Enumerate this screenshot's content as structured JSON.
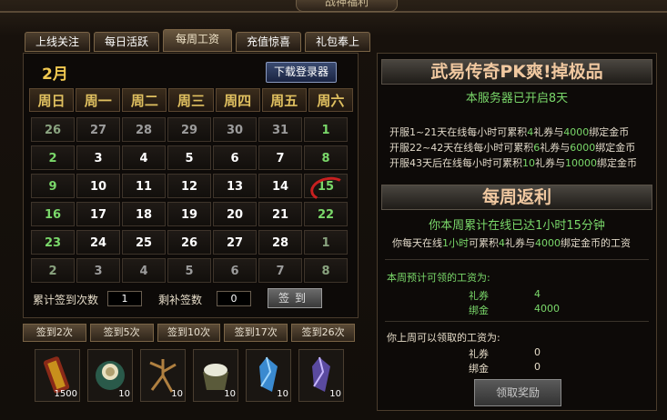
{
  "window": {
    "title": "战神福利"
  },
  "tabs": [
    {
      "label": "上线关注",
      "active": false
    },
    {
      "label": "每日活跃",
      "active": false
    },
    {
      "label": "每周工资",
      "active": true
    },
    {
      "label": "充值惊喜",
      "active": false
    },
    {
      "label": "礼包奉上",
      "active": false
    }
  ],
  "calendar": {
    "month": "2月",
    "download_button": "下载登录器",
    "weekdays": [
      "周日",
      "周一",
      "周二",
      "周三",
      "周四",
      "周五",
      "周六"
    ],
    "days": [
      {
        "d": "26",
        "c": "c-dim"
      },
      {
        "d": "27",
        "c": "c-gray"
      },
      {
        "d": "28",
        "c": "c-gray"
      },
      {
        "d": "29",
        "c": "c-gray"
      },
      {
        "d": "30",
        "c": "c-gray"
      },
      {
        "d": "31",
        "c": "c-gray"
      },
      {
        "d": "1",
        "c": "c-green"
      },
      {
        "d": "2",
        "c": "c-green"
      },
      {
        "d": "3",
        "c": "c-white"
      },
      {
        "d": "4",
        "c": "c-white"
      },
      {
        "d": "5",
        "c": "c-white"
      },
      {
        "d": "6",
        "c": "c-white"
      },
      {
        "d": "7",
        "c": "c-white"
      },
      {
        "d": "8",
        "c": "c-green"
      },
      {
        "d": "9",
        "c": "c-green"
      },
      {
        "d": "10",
        "c": "c-white"
      },
      {
        "d": "11",
        "c": "c-white"
      },
      {
        "d": "12",
        "c": "c-white"
      },
      {
        "d": "13",
        "c": "c-white"
      },
      {
        "d": "14",
        "c": "c-white"
      },
      {
        "d": "15",
        "c": "c-green c-today"
      },
      {
        "d": "16",
        "c": "c-green"
      },
      {
        "d": "17",
        "c": "c-white"
      },
      {
        "d": "18",
        "c": "c-white"
      },
      {
        "d": "19",
        "c": "c-white"
      },
      {
        "d": "20",
        "c": "c-white"
      },
      {
        "d": "21",
        "c": "c-white"
      },
      {
        "d": "22",
        "c": "c-green"
      },
      {
        "d": "23",
        "c": "c-green"
      },
      {
        "d": "24",
        "c": "c-white"
      },
      {
        "d": "25",
        "c": "c-white"
      },
      {
        "d": "26",
        "c": "c-white"
      },
      {
        "d": "27",
        "c": "c-white"
      },
      {
        "d": "28",
        "c": "c-white"
      },
      {
        "d": "1",
        "c": "c-dim"
      },
      {
        "d": "2",
        "c": "c-dim"
      },
      {
        "d": "3",
        "c": "c-gray"
      },
      {
        "d": "4",
        "c": "c-gray"
      },
      {
        "d": "5",
        "c": "c-gray"
      },
      {
        "d": "6",
        "c": "c-gray"
      },
      {
        "d": "7",
        "c": "c-gray"
      },
      {
        "d": "8",
        "c": "c-dim"
      }
    ],
    "total_label": "累计签到次数",
    "total_value": "1",
    "makeup_label": "剩补签数",
    "makeup_value": "0",
    "sign_button": "签到"
  },
  "reward_tabs": [
    "签到2次",
    "签到5次",
    "签到10次",
    "签到17次",
    "签到26次"
  ],
  "items": [
    {
      "icon": "scroll-icon",
      "count": "1500"
    },
    {
      "icon": "jade-icon",
      "count": "10"
    },
    {
      "icon": "root-icon",
      "count": "10"
    },
    {
      "icon": "silver-basket-icon",
      "count": "10"
    },
    {
      "icon": "blue-crystal-icon",
      "count": "10"
    },
    {
      "icon": "purple-crystal-icon",
      "count": "10"
    }
  ],
  "right": {
    "banner1": "武易传奇PK爽!掉极品",
    "server_open": "本服务器已开启8天",
    "rules": [
      {
        "a": "开服1~21天在线每小时可累积",
        "n1": "4",
        "b": "礼券与",
        "n2": "4000",
        "c": "绑定金币"
      },
      {
        "a": "开服22~42天在线每小时可累积",
        "n1": "6",
        "b": "礼券与",
        "n2": "6000",
        "c": "绑定金币"
      },
      {
        "a": "开服43天后在线每小时可累积",
        "n1": "10",
        "b": "礼券与",
        "n2": "10000",
        "c": "绑定金币"
      }
    ],
    "banner2": "每周返利",
    "week_online": "你本周累计在线已达1小时15分钟",
    "daily": {
      "a": "你每天在线",
      "h": "1小时",
      "b": "可累积",
      "n1": "4",
      "c": "礼券与",
      "n2": "4000",
      "d": "绑定金币的工资"
    },
    "predict_label": "本周预计可领的工资为:",
    "predict_coupon_label": "礼券",
    "predict_coupon": "4",
    "predict_gold_label": "绑金",
    "predict_gold": "4000",
    "last_label": "你上周可以领取的工资为:",
    "last_coupon_label": "礼券",
    "last_coupon": "0",
    "last_gold_label": "绑金",
    "last_gold": "0",
    "claim_button": "领取奖励"
  },
  "colors": {
    "gold": "#f0c850",
    "green": "#7ad86a",
    "banner": "#f0c8a0"
  }
}
